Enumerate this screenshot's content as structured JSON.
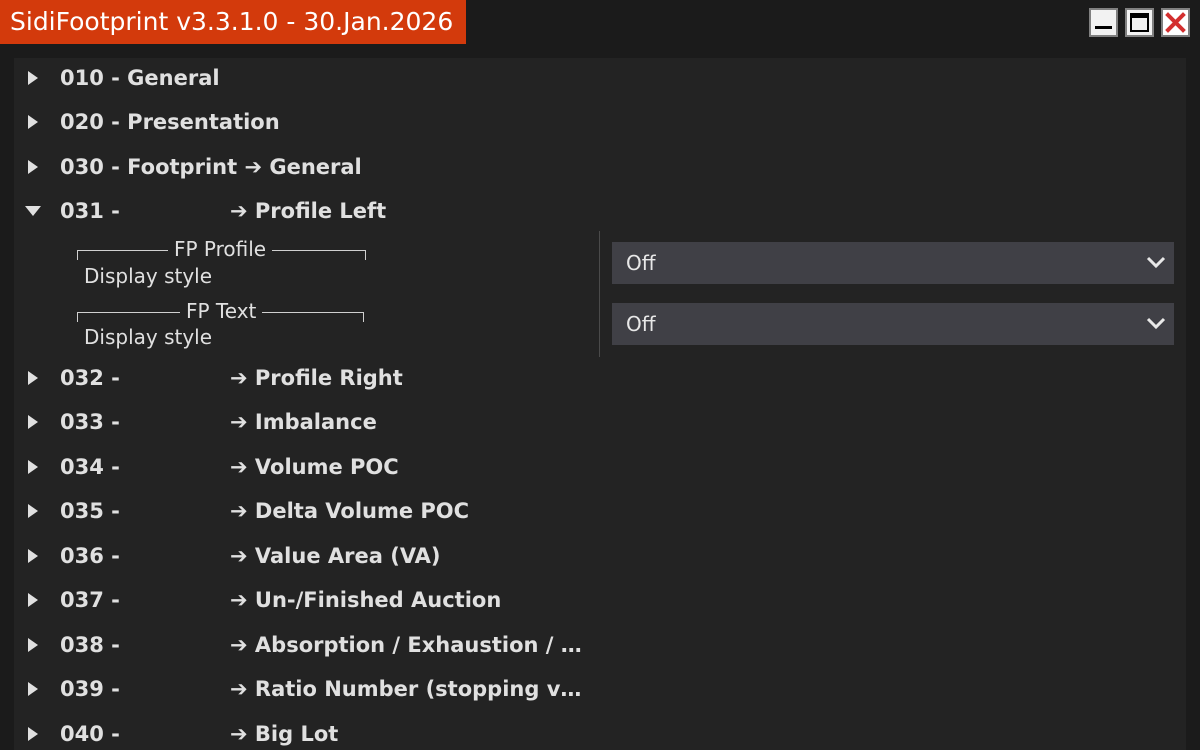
{
  "window": {
    "title": "SidiFootprint v3.3.1.0 - 30.Jan.2026",
    "minimize_icon": "minimize-icon",
    "maximize_icon": "maximize-icon",
    "close_icon": "close-icon",
    "close_color": "#d32f2f",
    "title_bg": "#d33a0c"
  },
  "tree": [
    {
      "num": "010 - General",
      "name": "",
      "expanded": false
    },
    {
      "num": "020 - Presentation",
      "name": "",
      "expanded": false
    },
    {
      "num": "030 - Footprint ➔ General",
      "name": "",
      "expanded": false
    },
    {
      "num": "031 -",
      "name": "➔ Profile Left",
      "expanded": true
    },
    {
      "num": "032 -",
      "name": "➔ Profile Right",
      "expanded": false
    },
    {
      "num": "033 -",
      "name": "➔ Imbalance",
      "expanded": false
    },
    {
      "num": "034 -",
      "name": "➔ Volume POC",
      "expanded": false
    },
    {
      "num": "035 -",
      "name": "➔ Delta Volume POC",
      "expanded": false
    },
    {
      "num": "036 -",
      "name": "➔ Value Area (VA)",
      "expanded": false
    },
    {
      "num": "037 -",
      "name": "➔ Un-/Finished Auction",
      "expanded": false
    },
    {
      "num": "038 -",
      "name": "➔ Absorption / Exhaustion / P...",
      "expanded": false
    },
    {
      "num": "039 -",
      "name": "➔ Ratio Number (stopping vo...",
      "expanded": false
    },
    {
      "num": "040 -",
      "name": "➔ Big Lot",
      "expanded": false
    }
  ],
  "expanded_section": {
    "groups": [
      {
        "title": "FP Profile",
        "label": "Display style",
        "value": "Off"
      },
      {
        "title": "FP Text",
        "label": "Display style",
        "value": "Off"
      }
    ]
  }
}
